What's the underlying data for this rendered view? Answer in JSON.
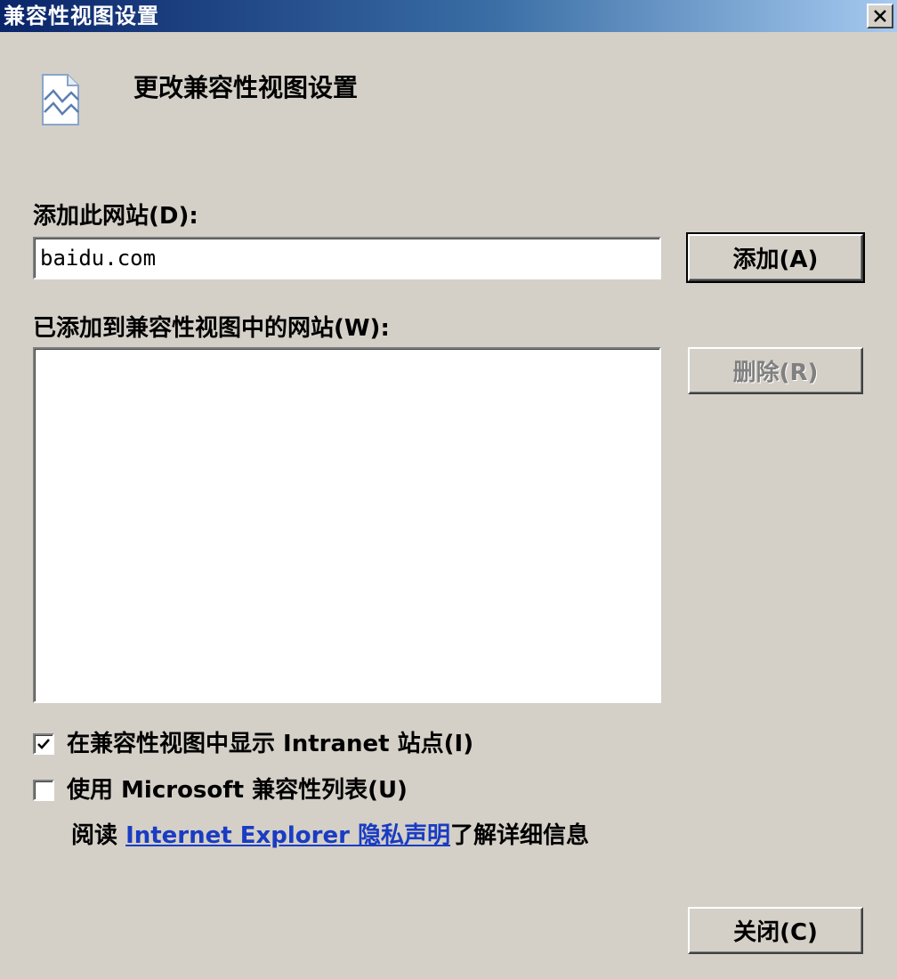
{
  "window": {
    "title": "兼容性视图设置",
    "close_icon": "close-icon"
  },
  "header": {
    "icon": "broken-page-icon",
    "text": "更改兼容性视图设置"
  },
  "add_site": {
    "label": "添加此网站(D):",
    "value": "baidu.com",
    "button_label": "添加(A)"
  },
  "site_list": {
    "label": "已添加到兼容性视图中的网站(W):",
    "items": [],
    "remove_button_label": "删除(R)"
  },
  "options": {
    "intranet": {
      "label": "在兼容性视图中显示 Intranet 站点(I)",
      "checked": true
    },
    "ms_list": {
      "label": "使用 Microsoft 兼容性列表(U)",
      "checked": false
    }
  },
  "privacy": {
    "prefix": "阅读 ",
    "link_text": "Internet Explorer 隐私声明",
    "suffix": "了解详细信息"
  },
  "footer": {
    "close_button_label": "关闭(C)"
  },
  "colors": {
    "face": "#d4d0c8",
    "title_start": "#0a246a",
    "title_end": "#a6caf0",
    "link": "#1a3cc2"
  }
}
